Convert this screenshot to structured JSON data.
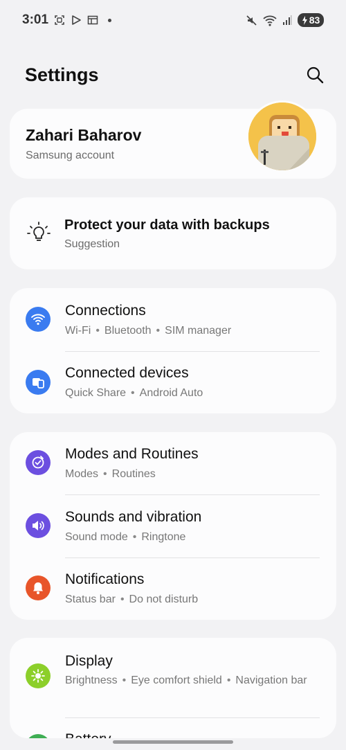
{
  "status_bar": {
    "time": "3:01",
    "battery": "83"
  },
  "header": {
    "title": "Settings"
  },
  "account": {
    "name": "Zahari Baharov",
    "subtitle": "Samsung account"
  },
  "suggestion": {
    "title": "Protect your data with backups",
    "subtitle": "Suggestion"
  },
  "groups": {
    "connections": {
      "title": "Connections",
      "sub": [
        "Wi-Fi",
        "Bluetooth",
        "SIM manager"
      ],
      "color": "#3a7bf0"
    },
    "connected_devices": {
      "title": "Connected devices",
      "sub": [
        "Quick Share",
        "Android Auto"
      ],
      "color": "#3a7bf0"
    },
    "modes": {
      "title": "Modes and Routines",
      "sub": [
        "Modes",
        "Routines"
      ],
      "color": "#6c4fe0"
    },
    "sounds": {
      "title": "Sounds and vibration",
      "sub": [
        "Sound mode",
        "Ringtone"
      ],
      "color": "#6c4fe0"
    },
    "notifications": {
      "title": "Notifications",
      "sub": [
        "Status bar",
        "Do not disturb"
      ],
      "color": "#e8552a"
    },
    "display": {
      "title": "Display",
      "sub": [
        "Brightness",
        "Eye comfort shield",
        "Navigation bar"
      ],
      "color": "#8ccf2a"
    },
    "battery": {
      "title": "Battery",
      "color": "#3fae54"
    }
  },
  "icons": {
    "status_left": [
      "screenshot-icon",
      "play-store-icon",
      "calendar-icon"
    ],
    "status_right": [
      "mute-icon",
      "wifi-icon",
      "signal-icon",
      "battery-icon"
    ],
    "search": "search-icon",
    "suggestion": "lightbulb-icon"
  }
}
